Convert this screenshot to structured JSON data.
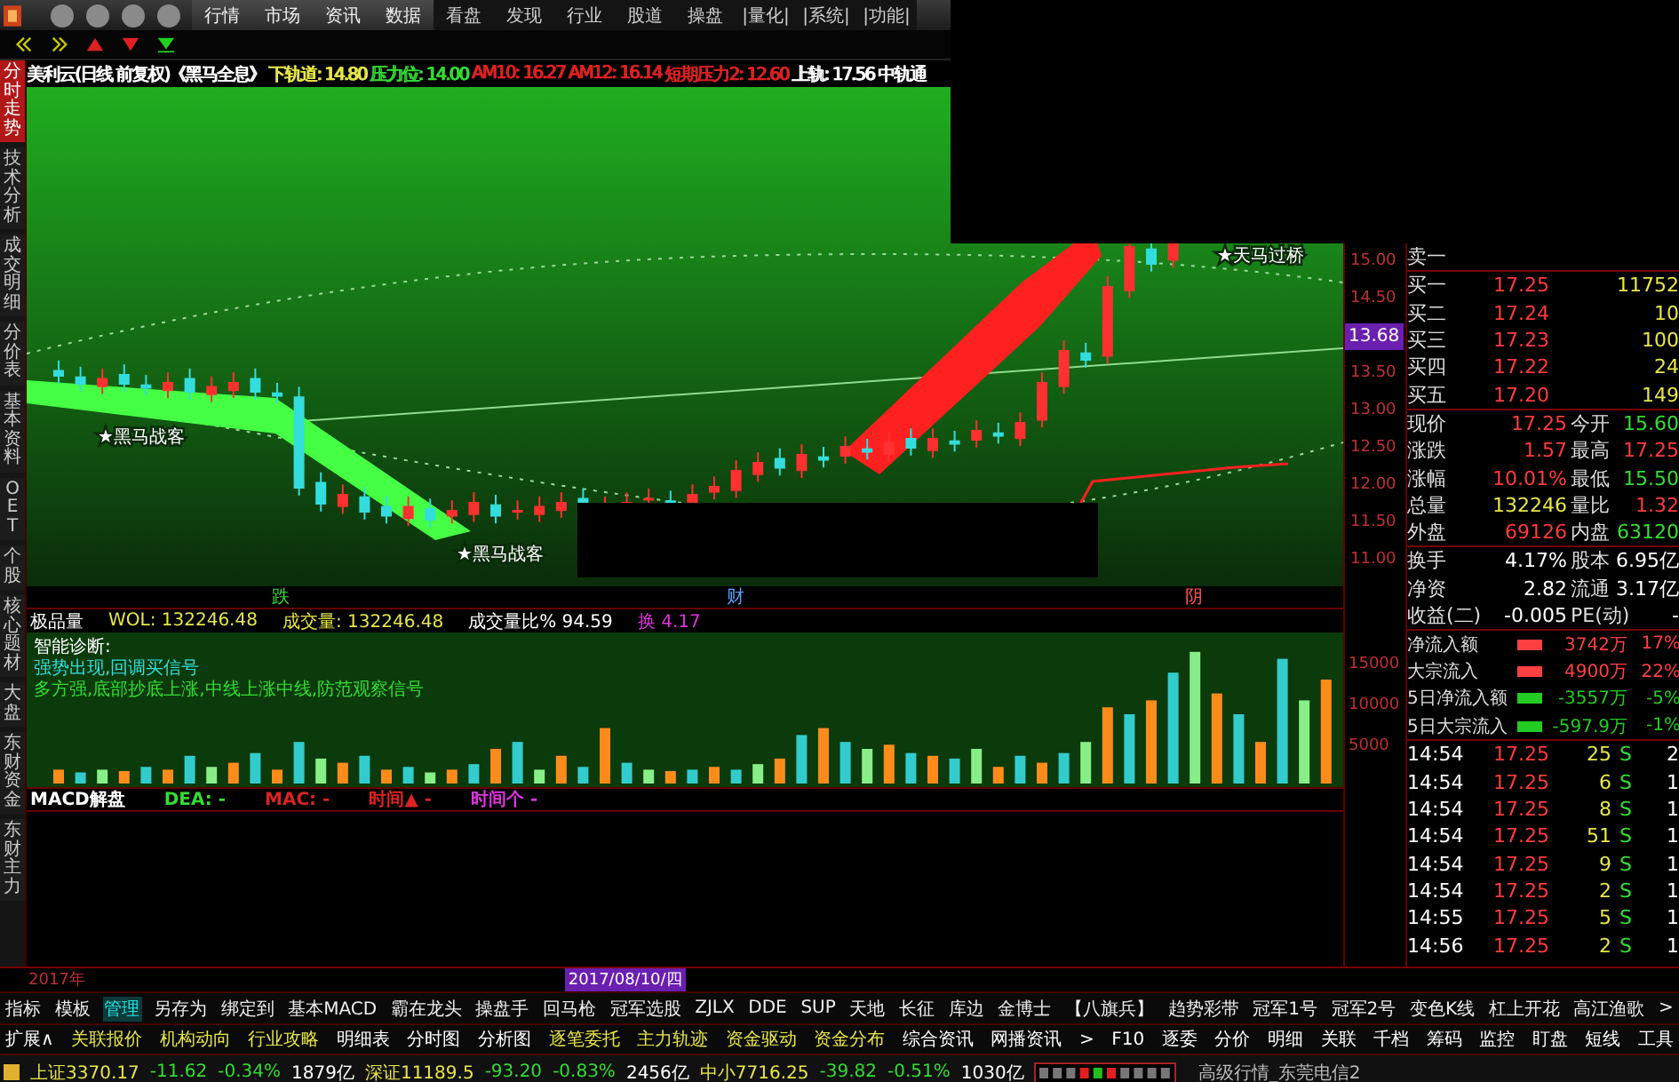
{
  "menu": {
    "items": [
      {
        "label": "行情",
        "kind": "main"
      },
      {
        "label": "市场",
        "kind": "main"
      },
      {
        "label": "资讯",
        "kind": "main"
      },
      {
        "label": "数据",
        "kind": "main"
      },
      {
        "label": "看盘",
        "kind": "extra"
      },
      {
        "label": "发现",
        "kind": "extra"
      },
      {
        "label": "行业",
        "kind": "extra"
      },
      {
        "label": "股道",
        "kind": "extra"
      },
      {
        "label": "操盘",
        "kind": "extra"
      },
      {
        "label": "|量化|",
        "kind": "extra"
      },
      {
        "label": "|系统|",
        "kind": "extra"
      },
      {
        "label": "|功能|",
        "kind": "extra"
      }
    ]
  },
  "side_tabs": [
    {
      "label": "分时走势",
      "selected": true
    },
    {
      "label": "技术分析",
      "selected": false
    },
    {
      "label": "成交明细",
      "selected": false
    },
    {
      "label": "分价表",
      "selected": false
    },
    {
      "label": "基本资料",
      "selected": false
    },
    {
      "label": "OET",
      "selected": false
    },
    {
      "label": "个股",
      "selected": false
    },
    {
      "label": "核心题材",
      "selected": false
    },
    {
      "label": "大盘",
      "selected": false
    },
    {
      "label": "东财资金",
      "selected": false
    },
    {
      "label": "东财主力",
      "selected": false
    }
  ],
  "chart_title": [
    {
      "text": "美利云(日线 前复权)《黑马全息》",
      "kind": "name"
    },
    {
      "text": "下轨道: 14.80",
      "kind": "lower"
    },
    {
      "text": "压力位: 14.00",
      "kind": "pressure"
    },
    {
      "text": "AM10: 16.27",
      "kind": "average"
    },
    {
      "text": "AM12: 16.14",
      "kind": "average"
    },
    {
      "text": "短期压力2: 12.60",
      "kind": "average"
    },
    {
      "text": "上轨: 17.56",
      "kind": "upper"
    },
    {
      "text": "中轨通",
      "kind": "upper"
    }
  ],
  "chart_labels": [
    {
      "text": "★黑马战客",
      "kind": "upper"
    },
    {
      "text": "★黑马战客",
      "kind": "lower"
    },
    {
      "text": "★天马过桥",
      "kind": "right"
    }
  ],
  "markers": [
    {
      "text": "跌",
      "color": "#33dd33"
    },
    {
      "text": "财",
      "color": "#5aa0ff"
    },
    {
      "text": "阴",
      "color": "#ff5050"
    }
  ],
  "price_axis": {
    "labels": [
      "15.00",
      "14.50",
      "13.50",
      "13.00",
      "12.50",
      "12.00",
      "11.50",
      "11.00"
    ],
    "cursor": "13.68"
  },
  "volume_header": [
    {
      "text": "极品量",
      "color": "#ffffff"
    },
    {
      "text": "WOL: 132246.48",
      "color": "#e6e64a"
    },
    {
      "text": "成交量: 132246.48",
      "color": "#e6e64a"
    },
    {
      "text": "成交量比% 94.59",
      "color": "#ffffff"
    },
    {
      "text": "换 4.17",
      "color": "#dd33dd"
    }
  ],
  "volume_notes": [
    {
      "text": "智能诊断:",
      "color": "#ffffff"
    },
    {
      "text": "强势出现,回调买信号",
      "color": "#33dddd"
    },
    {
      "text": "多方强,底部抄底上涨,中线上涨中线,防范观察信号",
      "color": "#33dd33"
    }
  ],
  "volume_axis": [
    "15000",
    "10000",
    "5000"
  ],
  "macd_header": [
    {
      "text": "MACD解盘",
      "kind": "title"
    },
    {
      "text": "DEA: -",
      "kind": "dea"
    },
    {
      "text": "MAC: -",
      "kind": "mac"
    },
    {
      "text": "时间▲ -",
      "kind": "mac"
    },
    {
      "text": "时间个 -",
      "kind": "time"
    }
  ],
  "date_axis": {
    "year": "2017年",
    "cursor": "2017/08/10/四"
  },
  "quote": {
    "ask": [
      {
        "label": "卖一"
      }
    ],
    "bids": [
      {
        "label": "买一",
        "price": "17.25",
        "volume": "11752"
      },
      {
        "label": "买二",
        "price": "17.24",
        "volume": "10"
      },
      {
        "label": "买三",
        "price": "17.23",
        "volume": "100"
      },
      {
        "label": "买四",
        "price": "17.22",
        "volume": "24"
      },
      {
        "label": "买五",
        "price": "17.20",
        "volume": "149"
      }
    ],
    "stats": [
      {
        "label": "现价",
        "value": "17.25",
        "color": "#ff3b3b"
      },
      {
        "label": "今开",
        "value": "15.60",
        "color": "#33dd33"
      },
      {
        "label": "涨跌",
        "value": "1.57",
        "color": "#ff3b3b"
      },
      {
        "label": "最高",
        "value": "17.25",
        "color": "#ff3b3b"
      },
      {
        "label": "涨幅",
        "value": "10.01%",
        "color": "#ff3b3b"
      },
      {
        "label": "最低",
        "value": "15.50",
        "color": "#33dd33"
      },
      {
        "label": "总量",
        "value": "132246",
        "color": "#e6e64a"
      },
      {
        "label": "量比",
        "value": "1.32",
        "color": "#ff3b3b"
      },
      {
        "label": "外盘",
        "value": "69126",
        "color": "#ff3b3b"
      },
      {
        "label": "内盘",
        "value": "63120",
        "color": "#33dd33"
      }
    ],
    "fundamentals": [
      {
        "label": "换手",
        "value": "4.17%"
      },
      {
        "label": "股本",
        "value": "6.95亿"
      },
      {
        "label": "净资",
        "value": "2.82"
      },
      {
        "label": "流通",
        "value": "3.17亿"
      },
      {
        "label": "收益(二)",
        "value": "-0.005"
      },
      {
        "label": "PE(动)",
        "value": "-"
      }
    ],
    "flows": [
      {
        "label": "净流入额",
        "amount": "3742万",
        "percent": "17%",
        "color": "#ff4040"
      },
      {
        "label": "大宗流入",
        "amount": "4900万",
        "percent": "22%",
        "color": "#ff4040"
      },
      {
        "label": "5日净流入额",
        "amount": "-3557万",
        "percent": "-5%",
        "color": "#22cc22"
      },
      {
        "label": "5日大宗流入",
        "amount": "-597.9万",
        "percent": "-1%",
        "color": "#22cc22"
      }
    ],
    "ticks": [
      {
        "time": "14:54",
        "price": "17.25",
        "volume": "25",
        "side": "S",
        "column_5": "2"
      },
      {
        "time": "14:54",
        "price": "17.25",
        "volume": "6",
        "side": "S",
        "column_5": "1"
      },
      {
        "time": "14:54",
        "price": "17.25",
        "volume": "8",
        "side": "S",
        "column_5": "1"
      },
      {
        "time": "14:54",
        "price": "17.25",
        "volume": "51",
        "side": "S",
        "column_5": "1"
      },
      {
        "time": "14:54",
        "price": "17.25",
        "volume": "9",
        "side": "S",
        "column_5": "1"
      },
      {
        "time": "14:54",
        "price": "17.25",
        "volume": "2",
        "side": "S",
        "column_5": "1"
      },
      {
        "time": "14:55",
        "price": "17.25",
        "volume": "5",
        "side": "S",
        "column_5": "1"
      },
      {
        "time": "14:56",
        "price": "17.25",
        "volume": "2",
        "side": "S",
        "column_5": "1"
      }
    ]
  },
  "toolbar_1": [
    {
      "label": "指标",
      "selected": false
    },
    {
      "label": "模板",
      "selected": false
    },
    {
      "label": "管理",
      "selected": true
    },
    {
      "label": "另存为",
      "selected": false
    },
    {
      "label": "绑定到",
      "selected": false
    },
    {
      "label": "基本MACD",
      "selected": false
    },
    {
      "label": "霸在龙头",
      "selected": false
    },
    {
      "label": "操盘手",
      "selected": false
    },
    {
      "label": "回马枪",
      "selected": false
    },
    {
      "label": "冠军选股",
      "selected": false
    },
    {
      "label": "ZJLX",
      "selected": false
    },
    {
      "label": "DDE",
      "selected": false
    },
    {
      "label": "SUP",
      "selected": false
    },
    {
      "label": "天地",
      "selected": false
    },
    {
      "label": "长征",
      "selected": false
    },
    {
      "label": "库边",
      "selected": false
    },
    {
      "label": "金博士",
      "selected": false
    },
    {
      "label": "【八旗兵】",
      "selected": false
    },
    {
      "label": "趋势彩带",
      "selected": false
    },
    {
      "label": "冠军1号",
      "selected": false
    },
    {
      "label": "冠军2号",
      "selected": false
    },
    {
      "label": "变色K线",
      "selected": false
    },
    {
      "label": "杠上开花",
      "selected": false
    },
    {
      "label": "高江渔歌",
      "selected": false
    },
    {
      "label": ">",
      "selected": false
    }
  ],
  "toolbar_2": [
    {
      "label": "扩展∧",
      "color": "#ffffff"
    },
    {
      "label": "关联报价",
      "color": "#e6e64a"
    },
    {
      "label": "机构动向",
      "color": "#e6e64a"
    },
    {
      "label": "行业攻略",
      "color": "#e6e64a"
    },
    {
      "label": "明细表",
      "color": "#ffffff"
    },
    {
      "label": "分时图",
      "color": "#ffffff"
    },
    {
      "label": "分析图",
      "color": "#ffffff"
    },
    {
      "label": "逐笔委托",
      "color": "#e6e64a"
    },
    {
      "label": "主力轨迹",
      "color": "#e6e64a"
    },
    {
      "label": "资金驱动",
      "color": "#e6e64a"
    },
    {
      "label": "资金分布",
      "color": "#e6e64a"
    },
    {
      "label": "综合资讯",
      "color": "#ffffff"
    },
    {
      "label": "网播资讯",
      "color": "#ffffff"
    },
    {
      "label": ">",
      "color": "#ffffff"
    },
    {
      "label": "F10",
      "color": "#ffffff"
    },
    {
      "label": "逐委",
      "color": "#ffffff"
    },
    {
      "label": "分价",
      "color": "#ffffff"
    },
    {
      "label": "明细",
      "color": "#ffffff"
    },
    {
      "label": "关联",
      "color": "#ffffff"
    },
    {
      "label": "千档",
      "color": "#ffffff"
    },
    {
      "label": "筹码",
      "color": "#ffffff"
    },
    {
      "label": "监控",
      "color": "#ffffff"
    },
    {
      "label": "盯盘",
      "color": "#ffffff"
    },
    {
      "label": "短线",
      "color": "#ffffff"
    },
    {
      "label": "工具",
      "color": "#ffffff"
    }
  ],
  "status_bar": {
    "indices": [
      {
        "text": "上证3370.17",
        "color": "#e6e64a"
      },
      {
        "text": "-11.62",
        "color": "#33dd33"
      },
      {
        "text": "-0.34%",
        "color": "#33dd33"
      },
      {
        "text": "1879亿",
        "color": "#ffffff"
      },
      {
        "text": "深证11189.5",
        "color": "#e6e64a"
      },
      {
        "text": "-93.20",
        "color": "#33dd33"
      },
      {
        "text": "-0.83%",
        "color": "#33dd33"
      },
      {
        "text": "2456亿",
        "color": "#ffffff"
      },
      {
        "text": "中小7716.25",
        "color": "#e6e64a"
      },
      {
        "text": "-39.82",
        "color": "#33dd33"
      },
      {
        "text": "-0.51%",
        "color": "#33dd33"
      },
      {
        "text": "1030亿",
        "color": "#ffffff"
      }
    ],
    "server": "高级行情_东莞电信2"
  }
}
